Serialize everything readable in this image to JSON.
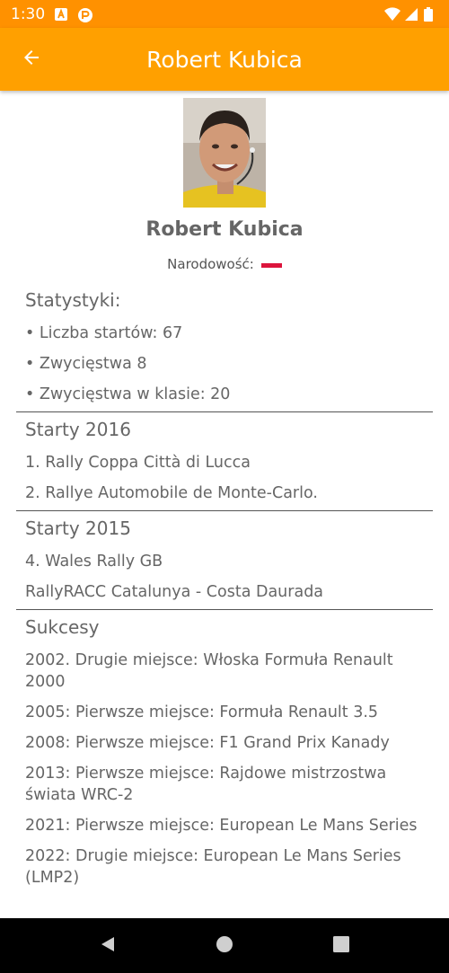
{
  "status_bar": {
    "time": "1:30"
  },
  "app_bar": {
    "title": "Robert Kubica"
  },
  "profile": {
    "name": "Robert Kubica",
    "nationality_label": "Narodowość:"
  },
  "sections": [
    {
      "title": "Statystyki:",
      "items": [
        "• Liczba startów: 67",
        "• Zwycięstwa 8",
        "• Zwycięstwa w klasie: 20"
      ]
    },
    {
      "title": "Starty 2016",
      "items": [
        "1. Rally Coppa Città di Lucca",
        "2. Rallye Automobile de Monte-Carlo."
      ]
    },
    {
      "title": "Starty 2015",
      "items": [
        "4. Wales Rally GB",
        "RallyRACC Catalunya - Costa Daurada"
      ]
    },
    {
      "title": "Sukcesy",
      "items": [
        "2002. Drugie miejsce: Włoska Formuła Renault 2000",
        "2005: Pierwsze miejsce: Formuła Renault 3.5",
        "2008: Pierwsze miejsce: F1 Grand Prix Kanady",
        "2013: Pierwsze miejsce: Rajdowe mistrzostwa świata WRC-2",
        "2021: Pierwsze miejsce: European Le Mans Series",
        "2022: Drugie miejsce: European Le Mans Series (LMP2)"
      ]
    }
  ],
  "colors": {
    "status_bar": "#FF9100",
    "app_bar": "#FFA000",
    "text": "#666666",
    "divider": "#555555",
    "flag_red": "#DC143C"
  },
  "icons": {
    "back": "arrow-back-icon",
    "nav_back": "triangle-back-icon",
    "nav_home": "circle-home-icon",
    "nav_recents": "square-recents-icon"
  }
}
